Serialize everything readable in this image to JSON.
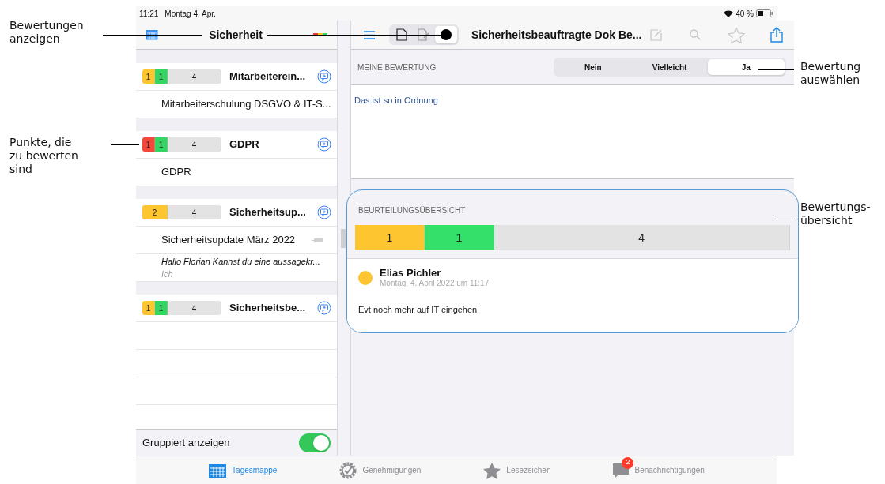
{
  "annotations_left": [
    "Bewertungen\nanzeigen",
    "Punkte, die\nzu bewerten\nsind"
  ],
  "annotations_right": [
    "Bewertung\nauswählen",
    "Bewertungs-\nübersicht"
  ],
  "status_bar": {
    "time": "11:21",
    "date": "Montag 4. Apr.",
    "battery": "40 %"
  },
  "sidebar": {
    "title": "Sicherheit",
    "groups": [
      {
        "title": "Mitarbeiterein...",
        "ratings": [
          {
            "kind": "rated",
            "count": "1",
            "color": "#fdc530"
          },
          {
            "kind": "rated",
            "count": "1",
            "color": "#34d663"
          },
          {
            "kind": "open",
            "count": "4",
            "color": "#e3e3e3"
          }
        ],
        "items": [
          {
            "kind": "document",
            "text": "Mitarbeiterschulung DSGVO & IT-S..."
          }
        ]
      },
      {
        "title": "GDPR",
        "ratings": [
          {
            "kind": "rated",
            "count": "1",
            "color": "#f2483a"
          },
          {
            "kind": "rated",
            "count": "1",
            "color": "#34d663"
          },
          {
            "kind": "open",
            "count": "4",
            "color": "#e3e3e3"
          }
        ],
        "items": [
          {
            "kind": "document",
            "text": "GDPR"
          }
        ]
      },
      {
        "title": "Sicherheitsup...",
        "ratings": [
          {
            "kind": "rated",
            "count": "2",
            "color": "#fdc530"
          },
          {
            "kind": "open",
            "count": "4",
            "color": "#e3e3e3"
          }
        ],
        "items": [
          {
            "kind": "document",
            "text": "Sicherheitsupdate März 2022"
          },
          {
            "kind": "comment",
            "text": "Hallo Florian Kannst du eine aussagekr...",
            "author": "Ich"
          }
        ]
      },
      {
        "title": "Sicherheitsbe...",
        "ratings": [
          {
            "kind": "rated",
            "count": "1",
            "color": "#fdc530"
          },
          {
            "kind": "rated",
            "count": "1",
            "color": "#34d663"
          },
          {
            "kind": "open",
            "count": "4",
            "color": "#e3e3e3"
          }
        ]
      }
    ],
    "toggle": {
      "label": "Gruppiert anzeigen",
      "on": true
    }
  },
  "document": {
    "title": "Sicherheitsbeauftragte Dok Be...",
    "views": [
      {
        "kind": "document",
        "selected": false
      },
      {
        "kind": "annotate",
        "selected": false
      },
      {
        "kind": "rating",
        "selected": true
      }
    ],
    "my_rating": {
      "label": "MEINE BEWERTUNG",
      "options": [
        {
          "label": "Nein",
          "selected": false
        },
        {
          "label": "Vielleicht",
          "selected": false
        },
        {
          "label": "Ja",
          "selected": true
        }
      ],
      "comment": "Das ist so in Ordnung"
    },
    "overview": {
      "title": "BEURTEILUNGSÜBERSICHT",
      "ratings": [
        {
          "kind": "rated",
          "count": "1",
          "color": "#fdc530"
        },
        {
          "kind": "rated",
          "count": "1",
          "color": "#34e06a"
        },
        {
          "kind": "open",
          "count": "4",
          "color": "#e3e3e3"
        }
      ],
      "reviews": [
        {
          "name": "Elias Pichler",
          "date": "Montag, 4. April 2022 um 11:17",
          "text": "Evt noch mehr auf IT eingehen",
          "color": "#fdc530"
        }
      ]
    }
  },
  "tab_bar": [
    {
      "label": "Tagesmappe",
      "kind": "folder",
      "selected": true
    },
    {
      "label": "Genehmigungen",
      "kind": "approval",
      "selected": false
    },
    {
      "label": "Lesezeichen",
      "kind": "bookmark",
      "selected": false
    },
    {
      "label": "Benachrichtigungen",
      "kind": "messages",
      "selected": false,
      "badge": "2"
    }
  ]
}
